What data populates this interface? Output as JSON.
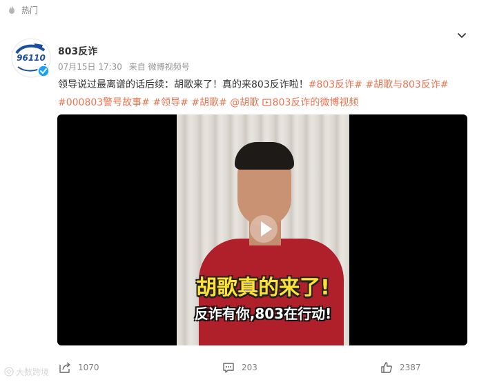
{
  "hot": {
    "label": "热门",
    "icon": "fire-icon"
  },
  "account": {
    "name": "803反诈",
    "avatar_text": "96110",
    "verified_icon": "verified-check-icon"
  },
  "meta": {
    "date": "07月15日 17:30",
    "source": "来自 微博视频号"
  },
  "post": {
    "text": "领导说过最离谱的话后续：胡歌来了！真的来803反诈啦！",
    "tags": [
      "#803反诈#",
      "#胡歌与803反诈#",
      "#000803警号故事#",
      "#领导#",
      "#胡歌#"
    ],
    "mention": "@胡歌",
    "video_link": "803反诈的微博视频"
  },
  "video": {
    "caption_main": "胡歌真的来了!",
    "caption_sub": "反诈有你,803在行动!"
  },
  "actions": {
    "share_count": "1070",
    "comment_count": "203",
    "like_count": "2387"
  },
  "watermark": "大数跨境",
  "colors": {
    "accent": "#eb7350",
    "text": "#333333",
    "muted": "#939393",
    "verified": "#1da1f2"
  }
}
